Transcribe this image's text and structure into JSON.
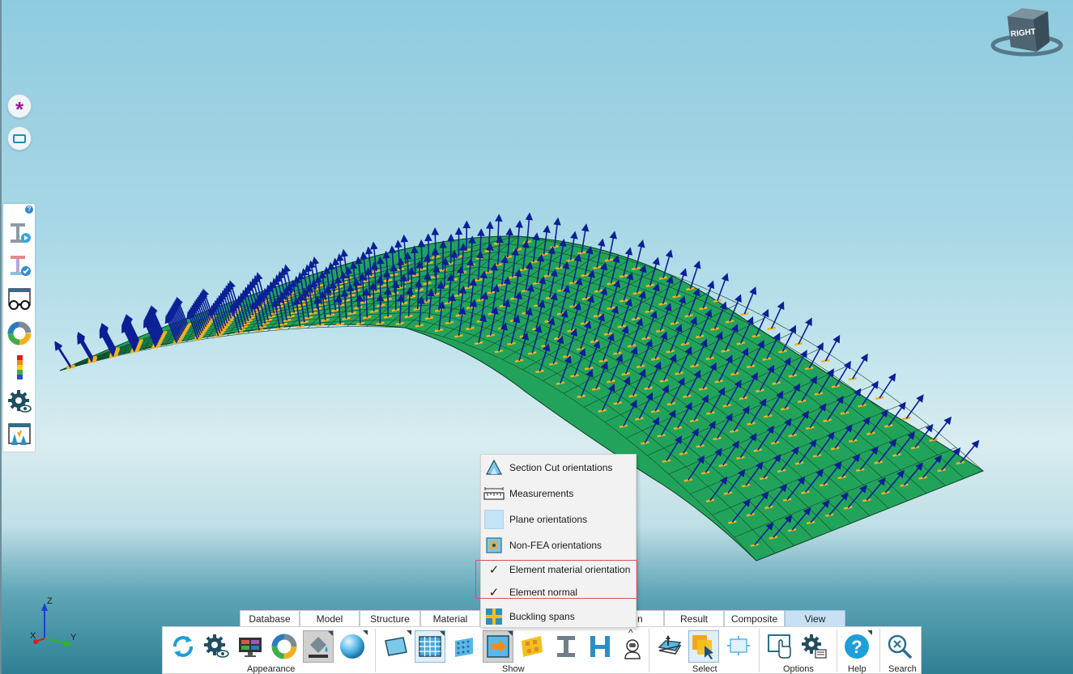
{
  "view_cube": {
    "face_label": "RIGHT"
  },
  "triad": {
    "z": "Z",
    "y": "Y",
    "x": "X"
  },
  "left_buttons": [
    {
      "name": "snap-asterisk-button",
      "icon": "asterisk-icon"
    },
    {
      "name": "window-select-button",
      "icon": "rectangle-icon"
    }
  ],
  "palette": {
    "help": "?",
    "tools": [
      "beam-play-icon",
      "beam-check-icon",
      "glasses-view-icon",
      "ring-color-icon",
      "colorbar-legend-icon",
      "gear-eye-icon",
      "screen-spark-icon"
    ]
  },
  "context_menu": {
    "items": [
      {
        "label": "Section Cut orientations",
        "checked": false,
        "icon": "section-cut-icon"
      },
      {
        "label": "Measurements",
        "checked": false,
        "icon": "ruler-icon"
      },
      {
        "label": "Plane orientations",
        "checked": false,
        "icon": "plane-icon"
      },
      {
        "label": "Non-FEA orientations",
        "checked": false,
        "icon": "non-fea-icon"
      },
      {
        "label": "Element material orientation",
        "checked": true,
        "icon": "check-icon"
      },
      {
        "label": "Element normal",
        "checked": true,
        "icon": "check-icon"
      },
      {
        "label": "Buckling spans",
        "checked": false,
        "icon": "buckling-spans-icon"
      }
    ],
    "check_glyph": "✓"
  },
  "tabs": [
    {
      "label": "Database",
      "active": false
    },
    {
      "label": "Model",
      "active": false
    },
    {
      "label": "Structure",
      "active": false
    },
    {
      "label": "Material",
      "active": false
    },
    {
      "label": "n",
      "active": false
    },
    {
      "label": "Result",
      "active": false
    },
    {
      "label": "Composite",
      "active": false
    },
    {
      "label": "View",
      "active": true
    }
  ],
  "ribbon": {
    "groups": [
      {
        "label": "Appearance"
      },
      {
        "label": "Show"
      },
      {
        "label": "Select"
      },
      {
        "label": "Options"
      },
      {
        "label": "Help"
      },
      {
        "label": "Search"
      }
    ],
    "collapse_glyph": "^"
  },
  "colors": {
    "mesh_fill": "#22a35c",
    "normal_arrow": "#0b1f96",
    "material_marker": "#f0b21f",
    "selection_highlight": "#d9534f",
    "active_tab": "#c7e0f4"
  }
}
